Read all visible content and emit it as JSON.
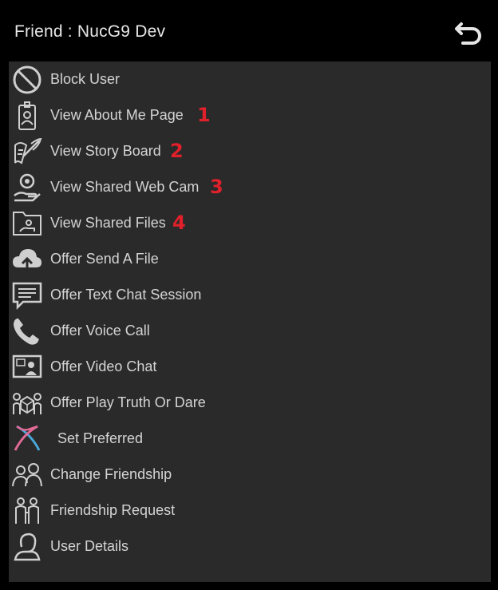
{
  "header": {
    "title": "Friend : NucG9 Dev",
    "back_icon": "undo-arrow-icon"
  },
  "colors": {
    "background": "#000000",
    "panel": "#2a2a2a",
    "text": "#d4d4d4",
    "badge": "#e0202a",
    "preferred_pink": "#e36a96",
    "preferred_blue": "#4aa8d8"
  },
  "menu": {
    "items": [
      {
        "label": "Block User",
        "icon": "block-icon"
      },
      {
        "label": "View About Me Page",
        "icon": "id-badge-icon",
        "badge": "1"
      },
      {
        "label": "View Story Board",
        "icon": "quill-scroll-icon",
        "badge": "2"
      },
      {
        "label": "View Shared Web Cam",
        "icon": "webcam-hand-icon",
        "badge": "3"
      },
      {
        "label": "View Shared Files",
        "icon": "shared-folder-icon",
        "badge": "4"
      },
      {
        "label": "Offer Send A File",
        "icon": "cloud-upload-icon"
      },
      {
        "label": "Offer Text Chat Session",
        "icon": "chat-bubble-icon"
      },
      {
        "label": "Offer Voice Call",
        "icon": "phone-icon"
      },
      {
        "label": "Offer Video Chat",
        "icon": "video-chat-icon"
      },
      {
        "label": "Offer Play Truth Or Dare",
        "icon": "truth-or-dare-icon"
      },
      {
        "label": "Set Preferred",
        "icon": "preferred-icon"
      },
      {
        "label": "Change Friendship",
        "icon": "friends-icon"
      },
      {
        "label": "Friendship Request",
        "icon": "friendship-request-icon"
      },
      {
        "label": "User Details",
        "icon": "user-details-icon"
      }
    ]
  }
}
